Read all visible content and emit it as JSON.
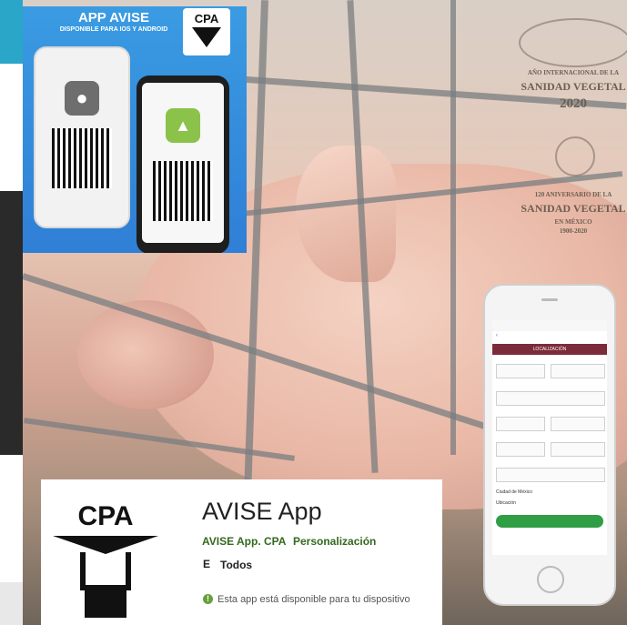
{
  "promo": {
    "title": "APP AVISE",
    "subtitle": "DISPONIBLE PARA IOS Y ANDROID",
    "logo_text": "CPA",
    "apple_icon": "apple-icon",
    "android_icon": "android-icon"
  },
  "watermark": {
    "line1": "AÑO INTERNACIONAL DE LA",
    "line2": "SANIDAD VEGETAL",
    "line3": "2020",
    "line4": "120 ANIVERSARIO DE LA",
    "line5": "SANIDAD VEGETAL",
    "line6": "EN MÉXICO",
    "line7": "1900-2020"
  },
  "phone": {
    "header": "LOCALIZACIÓN",
    "field_city": "Ciudad de México",
    "field_location": "Ubicación"
  },
  "store": {
    "app_title": "AVISE App",
    "developer": "AVISE App. CPA",
    "category": "Personalización",
    "rating_icon": "E",
    "rating": "Todos",
    "availability": "Esta app está disponible para tu dispositivo",
    "logo_text": "CPA"
  },
  "colors": {
    "promo_blue": "#2f7fd6",
    "store_green": "#33691e",
    "phone_header": "#7c2b3a",
    "button_green": "#2f9e44"
  }
}
